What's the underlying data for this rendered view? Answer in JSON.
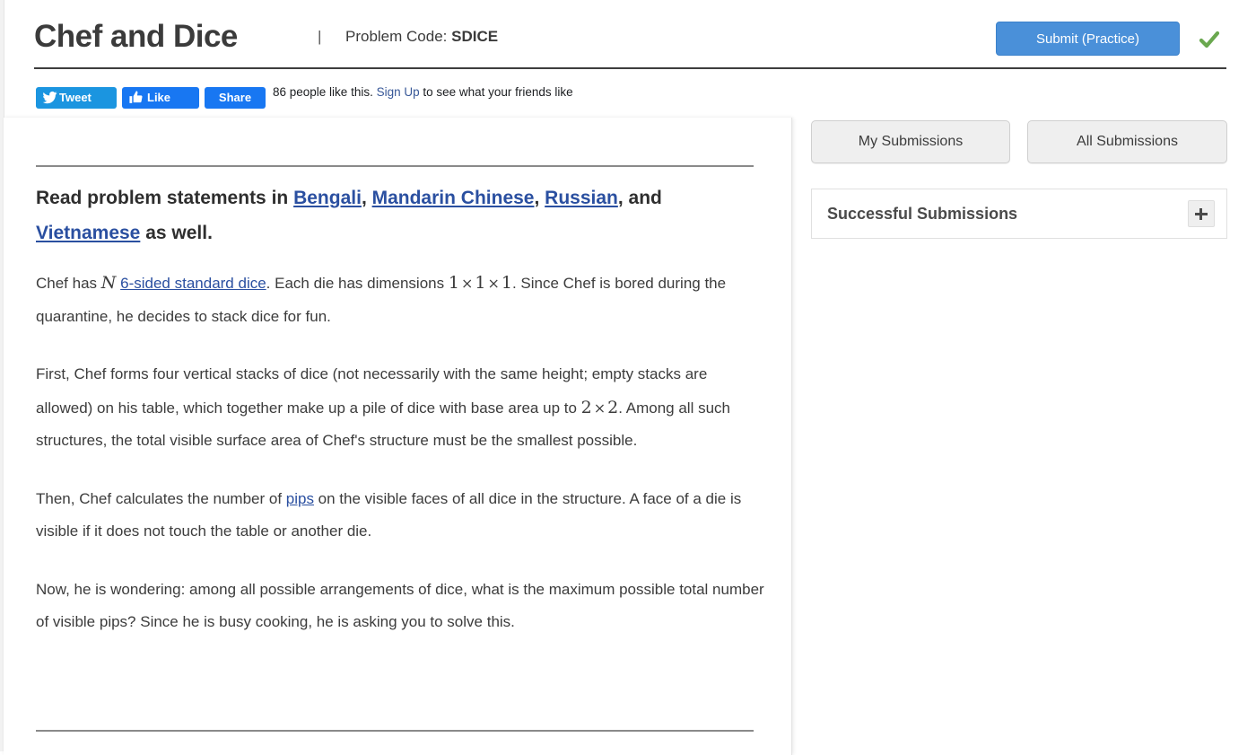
{
  "header": {
    "title": "Chef and Dice",
    "separator": "|",
    "problem_code_label": "Problem Code:",
    "problem_code": "SDICE",
    "submit_label": "Submit (Practice)",
    "status_icon": "check-icon",
    "accent_color": "#4a90d9",
    "status_color": "#6aa84f"
  },
  "social": {
    "tweet_label": "Tweet",
    "tweet_icon": "twitter-bird-icon",
    "like_label": "Like",
    "like_icon": "thumbs-up-icon",
    "share_label": "Share",
    "like_count_text_before": "86 people like this. ",
    "sign_up_label": "Sign Up",
    "like_count_text_after": " to see what your friends like",
    "tweet_color": "#1b95e0",
    "facebook_color": "#1877f2"
  },
  "statement": {
    "languages_prefix": "Read problem statements in ",
    "languages": [
      {
        "label": "Bengali",
        "after": ", "
      },
      {
        "label": "Mandarin Chinese",
        "after": ", "
      },
      {
        "label": "Russian",
        "after": ", and "
      },
      {
        "label": "Vietnamese",
        "after": " as well."
      }
    ],
    "p1_a": "Chef has ",
    "p1_var_n": "N",
    "p1_link_dice": "6-sided standard dice",
    "p1_b": ". Each die has dimensions ",
    "p1_dim_1": "1",
    "p1_times": "×",
    "p1_dim_2": "1",
    "p1_dim_3": "1",
    "p1_c": ". Since Chef is bored during the quarantine, he decides to stack dice for fun.",
    "p2_a": "First, Chef forms four vertical stacks of dice (not necessarily with the same height; empty stacks are allowed) on his table, which together make up a pile of dice with base area up to ",
    "p2_base_a": "2",
    "p2_times": "×",
    "p2_base_b": "2",
    "p2_b": ". Among all such structures, the total visible surface area of Chef's structure must be the smallest possible.",
    "p3_a": "Then, Chef calculates the number of ",
    "p3_link_pips": "pips",
    "p3_b": " on the visible faces of all dice in the structure. A face of a die is visible if it does not touch the table or another die.",
    "p4": "Now, he is wondering: among all possible arrangements of dice, what is the maximum possible total number of visible pips? Since he is busy cooking, he is asking you to solve this."
  },
  "sidebar": {
    "tab_my_submissions": "My Submissions",
    "tab_all_submissions": "All Submissions",
    "panel_title": "Successful Submissions",
    "panel_toggle_icon": "plus-icon"
  }
}
